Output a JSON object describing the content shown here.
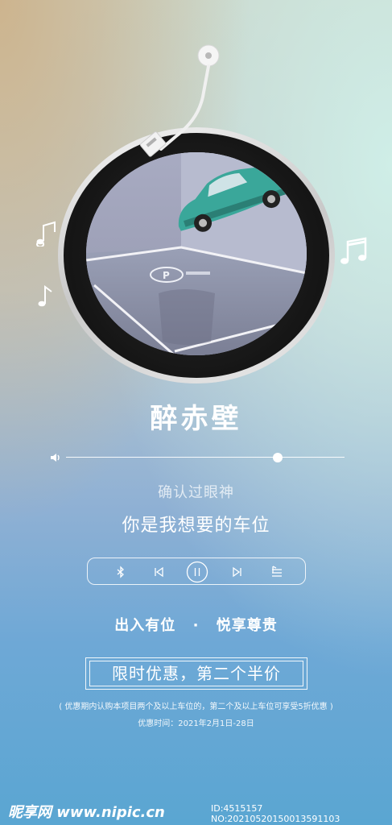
{
  "song_title": "醉赤壁",
  "volume_level": 0.76,
  "lyrics": {
    "line1": "确认过眼神",
    "line2": "你是我想要的车位"
  },
  "controls": [
    {
      "name": "bluetooth-icon"
    },
    {
      "name": "previous-icon"
    },
    {
      "name": "pause-icon"
    },
    {
      "name": "next-icon"
    },
    {
      "name": "playlist-icon"
    }
  ],
  "slogan": {
    "left": "出入有位",
    "separator": "·",
    "right": "悦享尊贵"
  },
  "promo": {
    "headline": "限时优惠，第二个半价",
    "note": "( 优惠期内认购本项目两个及以上车位的，第二个及以上车位可享受5折优惠 )",
    "time": "优惠时间：2021年2月1日-28日"
  },
  "watermark": {
    "site": "昵享网 www.nipic.cn",
    "id": "ID:4515157 NO:20210520150013591103"
  },
  "colors": {
    "text": "#ffffff",
    "car": "#3aa79a"
  }
}
